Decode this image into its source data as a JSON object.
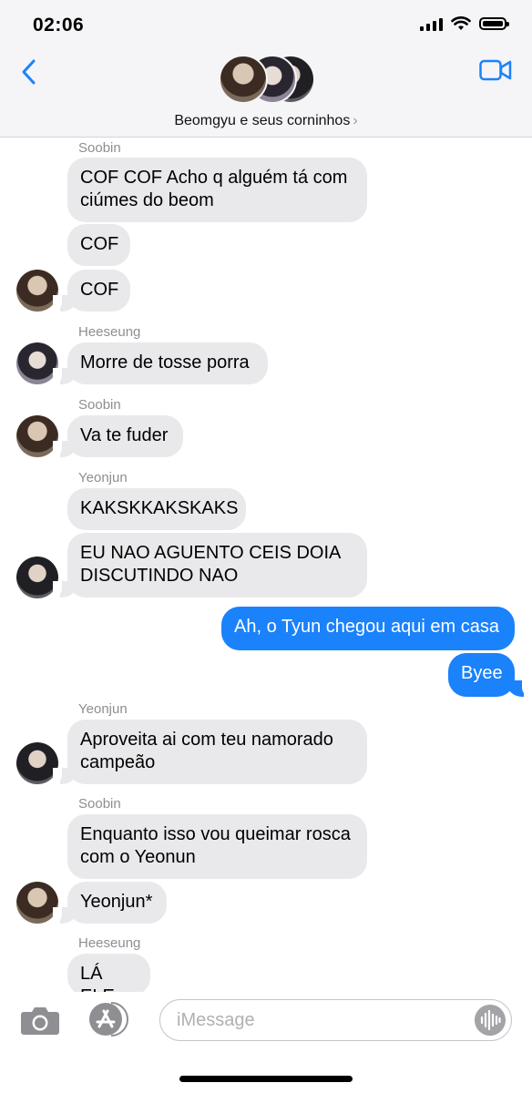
{
  "status_bar": {
    "time": "02:06"
  },
  "header": {
    "group_name": "Beomgyu e seus corninhos"
  },
  "messages": {
    "m1": {
      "sender": "Soobin",
      "text": "COF COF Acho q alguém tá com\nciúmes do beom"
    },
    "m2": {
      "text": "COF"
    },
    "m3": {
      "text": "COF"
    },
    "m4": {
      "sender": "Heeseung",
      "text": "Morre de tosse porra"
    },
    "m5": {
      "sender": "Soobin",
      "text": "Va te fuder"
    },
    "m6": {
      "sender": "Yeonjun",
      "text": "KAKSKKAKSKAKS"
    },
    "m7": {
      "text": "EU NAO AGUENTO CEIS DOIA\nDISCUTINDO NAO"
    },
    "m8": {
      "text": "Ah, o Tyun chegou aqui em casa"
    },
    "m9": {
      "text": "Byee"
    },
    "m10": {
      "sender": "Yeonjun",
      "text": "Aproveita ai com teu namorado\ncampeão"
    },
    "m11": {
      "sender": "Soobin",
      "text": "Enquanto isso vou queimar rosca\ncom o Yeonun"
    },
    "m12": {
      "text": "Yeonjun*"
    },
    "m13": {
      "sender": "Heeseung",
      "text": "LÁ ELE"
    }
  },
  "input": {
    "placeholder": "iMessage"
  },
  "colors": {
    "outgoing": "#1a82fb",
    "incoming": "#e9e9eb",
    "accent": "#1a82fb"
  },
  "icons": [
    "back-chevron-icon",
    "video-camera-icon",
    "camera-icon",
    "app-store-icon",
    "audio-waveform-icon",
    "wifi-icon",
    "signal-icon",
    "battery-icon"
  ]
}
